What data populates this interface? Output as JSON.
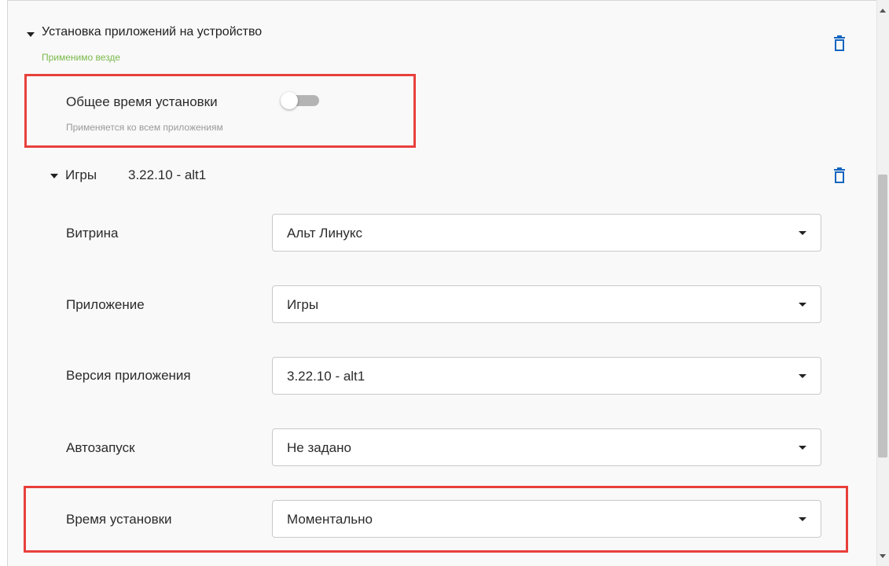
{
  "section": {
    "title": "Установка приложений на устройство",
    "subtitle": "Применимо везде",
    "delete_icon": "trash-icon"
  },
  "common_install": {
    "label": "Общее время установки",
    "hint": "Применяется ко всем приложениям",
    "toggle_on": false
  },
  "app_entry": {
    "name": "Игры",
    "version": "3.22.10 - alt1",
    "delete_icon": "trash-icon"
  },
  "fields": [
    {
      "label": "Витрина",
      "value": "Альт Линукс"
    },
    {
      "label": "Приложение",
      "value": "Игры"
    },
    {
      "label": "Версия приложения",
      "value": "3.22.10 - alt1"
    },
    {
      "label": "Автозапуск",
      "value": "Не задано"
    },
    {
      "label": "Время установки",
      "value": "Моментально"
    }
  ],
  "colors": {
    "accent_blue": "#1565c0",
    "highlight_red": "#e8403c",
    "subtitle_green": "#79b94a"
  }
}
